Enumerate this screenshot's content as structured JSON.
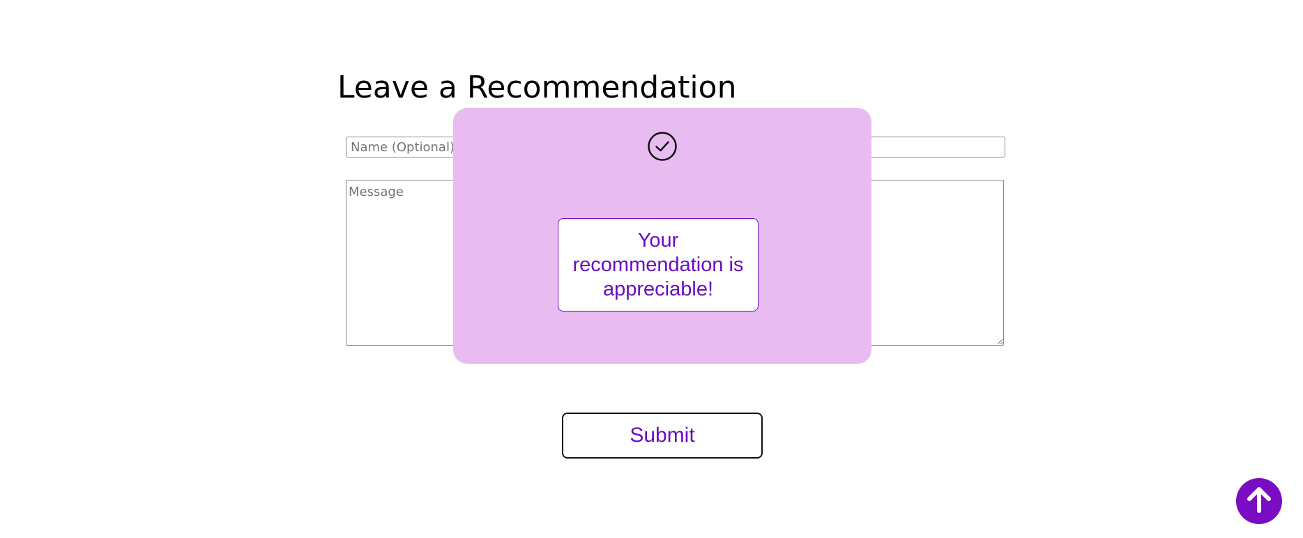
{
  "form": {
    "title": "Leave a Recommendation",
    "name_placeholder": "Name (Optional)",
    "name_value": "",
    "message_placeholder": "Message",
    "message_value": "",
    "submit_label": "Submit"
  },
  "modal": {
    "icon": "check-circle-icon",
    "message": "Your recommendation is appreciable!"
  },
  "scroll_top": {
    "icon": "arrow-up-icon"
  },
  "colors": {
    "accent": "#6a0dbf",
    "modal_background": "#e8bcf0",
    "scroll_button": "#7a0cc4"
  }
}
